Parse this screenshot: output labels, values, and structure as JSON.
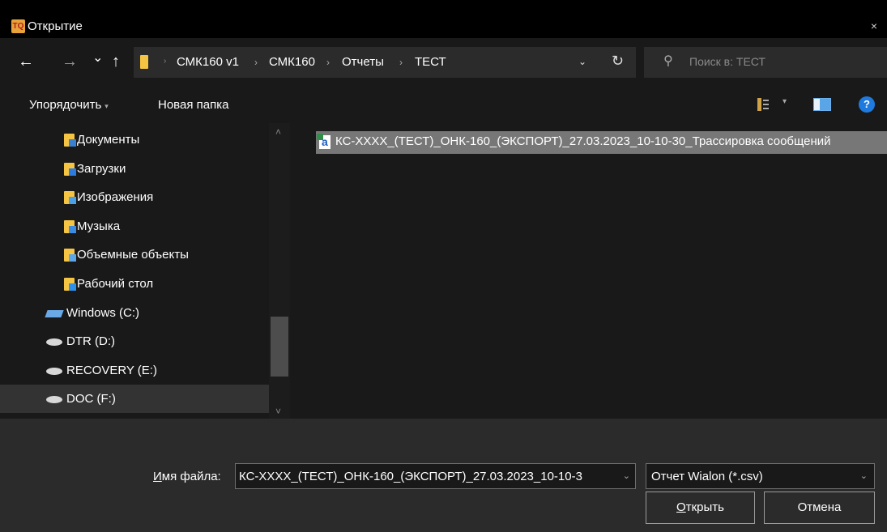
{
  "window": {
    "title": "Открытие",
    "close": "×",
    "app_icon_text": "TQ"
  },
  "nav": {
    "back": "←",
    "forward": "→",
    "recent": "⌄",
    "up": "↑",
    "breadcrumb": [
      "СМК160 v1",
      "СМК160",
      "Отчеты",
      "ТЕСТ"
    ],
    "breadcrumb_sep": "›",
    "addr_dropdown": "⌄",
    "refresh": "↻",
    "search_placeholder": "Поиск в: ТЕСТ"
  },
  "toolbar": {
    "organize": "Упорядочить",
    "new_folder": "Новая папка",
    "help": "?"
  },
  "sidebar": {
    "items": [
      {
        "label": "Документы",
        "icon": "documents-folder-icon",
        "type": "folder"
      },
      {
        "label": "Загрузки",
        "icon": "downloads-folder-icon",
        "type": "folder"
      },
      {
        "label": "Изображения",
        "icon": "pictures-folder-icon",
        "type": "folder"
      },
      {
        "label": "Музыка",
        "icon": "music-folder-icon",
        "type": "folder"
      },
      {
        "label": "Объемные объекты",
        "icon": "3d-objects-folder-icon",
        "type": "folder"
      },
      {
        "label": "Рабочий стол",
        "icon": "desktop-folder-icon",
        "type": "folder"
      },
      {
        "label": "Windows (C:)",
        "icon": "windows-drive-icon",
        "type": "drive-win"
      },
      {
        "label": "DTR (D:)",
        "icon": "drive-icon",
        "type": "drive"
      },
      {
        "label": "RECOVERY (E:)",
        "icon": "drive-icon",
        "type": "drive"
      },
      {
        "label": "DOC (F:)",
        "icon": "drive-icon",
        "type": "drive",
        "selected": true
      }
    ]
  },
  "files": [
    {
      "name": "КС-XXXX_(ТЕСТ)_ОНК-160_(ЭКСПОРТ)_27.03.2023_10-10-30_Трассировка сообщений",
      "icon": "csv-file-icon",
      "selected": true
    }
  ],
  "bottom": {
    "filename_label_accel": "И",
    "filename_label_rest": "мя файла:",
    "filename_value": "КС-XXXX_(ТЕСТ)_ОНК-160_(ЭКСПОРТ)_27.03.2023_10-10-3",
    "filetype": "Отчет Wialon (*.csv)",
    "open_accel": "О",
    "open_rest": "ткрыть",
    "cancel": "Отмена"
  },
  "colors": {
    "background": "#191919",
    "accent": "#1f7ae0",
    "folder": "#f6c443",
    "selection": "#777777"
  }
}
